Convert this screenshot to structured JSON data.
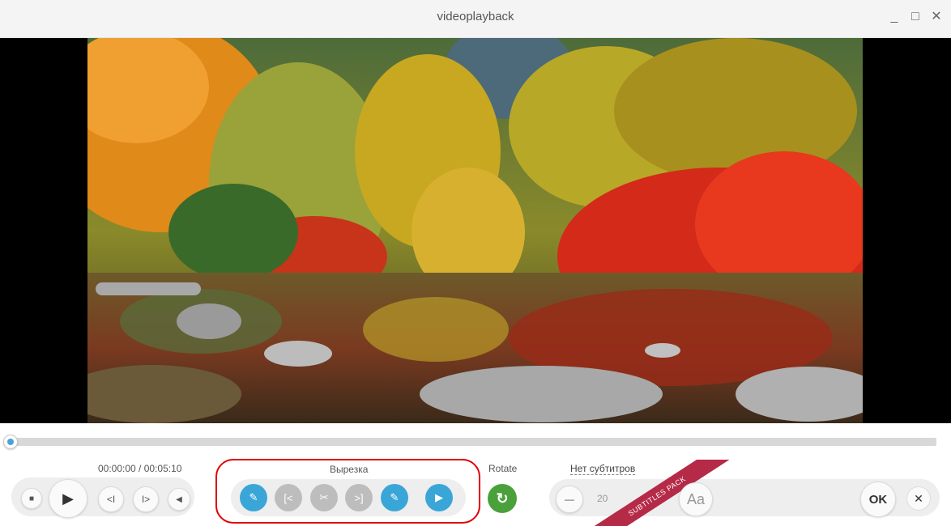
{
  "window": {
    "title": "videoplayback",
    "minimize_glyph": "_",
    "maximize_glyph": "□",
    "close_glyph": "✕"
  },
  "player": {
    "time": "00:00:00 / 00:05:10",
    "progress": 0,
    "buttons": {
      "stop": "■",
      "play": "▶",
      "prev_frame": "<I",
      "next_frame": "I>",
      "volume": "◀"
    }
  },
  "cut": {
    "label": "Вырезка",
    "buttons": [
      {
        "name": "mark-start-icon",
        "glyph": "✎",
        "color": "#3aa6d8"
      },
      {
        "name": "go-to-start-icon",
        "glyph": "[<",
        "color": "#bdbdbd"
      },
      {
        "name": "scissors-icon",
        "glyph": "✂",
        "color": "#bdbdbd"
      },
      {
        "name": "go-to-end-icon",
        "glyph": ">]",
        "color": "#bdbdbd"
      },
      {
        "name": "mark-end-icon",
        "glyph": "✎",
        "color": "#3aa6d8"
      },
      {
        "name": "preview-icon",
        "glyph": "▶",
        "color": "#3aa6d8"
      }
    ]
  },
  "rotate": {
    "label": "Rotate",
    "glyph": "↻",
    "color": "#4aa03a"
  },
  "subtitles": {
    "link": "Нет субтитров",
    "minus_glyph": "—",
    "size": "20",
    "font_button": "Aa",
    "ribbon": "SUBTITLES PACK",
    "ribbon_color": "#b52a47"
  },
  "actions": {
    "ok": "OK",
    "cancel": "✕"
  },
  "accent": "#4aa3d8"
}
